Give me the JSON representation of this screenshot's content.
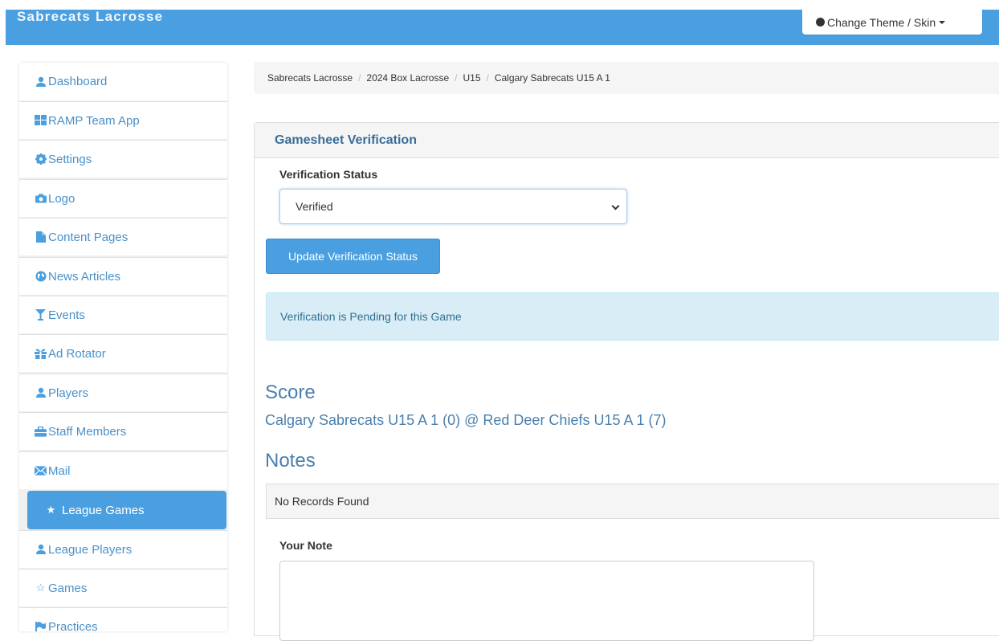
{
  "app": {
    "brand": "Sabrecats Lacrosse",
    "theme_button": "Change Theme / Skin"
  },
  "sidebar": {
    "items": [
      {
        "label": "Dashboard",
        "icon": "user-icon"
      },
      {
        "label": "RAMP Team App",
        "icon": "grid-icon"
      },
      {
        "label": "Settings",
        "icon": "gear-icon"
      },
      {
        "label": "Logo",
        "icon": "camera-icon"
      },
      {
        "label": "Content Pages",
        "icon": "file-icon"
      },
      {
        "label": "News Articles",
        "icon": "globe-icon"
      },
      {
        "label": "Events",
        "icon": "glass-icon"
      },
      {
        "label": "Ad Rotator",
        "icon": "gift-icon"
      },
      {
        "label": "Players",
        "icon": "user-icon"
      },
      {
        "label": "Staff Members",
        "icon": "briefcase-icon"
      },
      {
        "label": "Mail",
        "icon": "envelope-icon"
      },
      {
        "label": "League Games",
        "icon": "star-icon",
        "active": true
      },
      {
        "label": "League Players",
        "icon": "user-icon"
      },
      {
        "label": "Games",
        "icon": "star-outline-icon"
      },
      {
        "label": "Practices",
        "icon": "flag-icon"
      }
    ]
  },
  "breadcrumb": [
    "Sabrecats Lacrosse",
    "2024 Box Lacrosse",
    "U15",
    "Calgary Sabrecats U15 A 1"
  ],
  "panel": {
    "heading": "Gamesheet Verification",
    "status_label": "Verification Status",
    "status_value": "Verified",
    "update_button": "Update Verification Status",
    "alert": "Verification is Pending for this Game",
    "score_title": "Score",
    "score_text": "Calgary Sabrecats U15 A 1 (0) @ Red Deer Chiefs U15 A 1 (7)",
    "notes_title": "Notes",
    "no_records": "No Records Found",
    "note_label": "Your Note"
  },
  "colors": {
    "accent": "#4a9fe0",
    "link": "#4a7fad",
    "alert_bg": "#d9edf7"
  }
}
